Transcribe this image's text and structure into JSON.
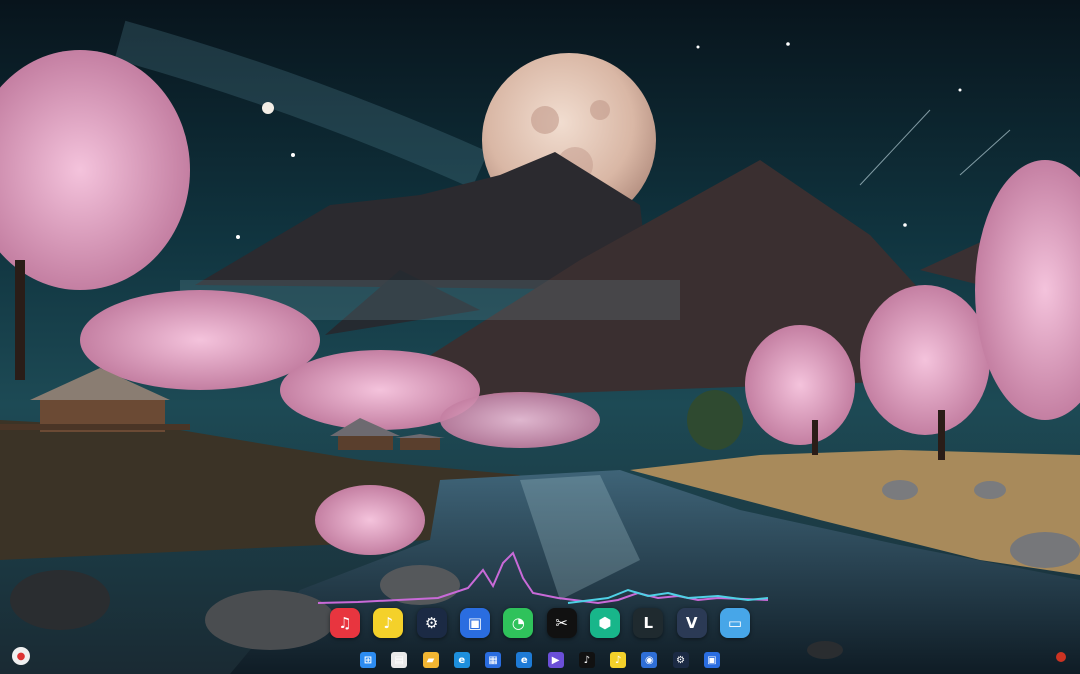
{
  "desktop": {
    "wallpaper_scene": "moonlit-mountains-cherry-blossoms"
  },
  "dock": {
    "apps": [
      {
        "name": "netease-music-icon",
        "glyph": "♫",
        "color": "#e8353f"
      },
      {
        "name": "qq-music-icon",
        "glyph": "♪",
        "color": "#f4d12a"
      },
      {
        "name": "steam-icon",
        "glyph": "⚙",
        "color": "#1b2a44"
      },
      {
        "name": "screenshot-icon",
        "glyph": "▣",
        "color": "#2a6de0"
      },
      {
        "name": "wechat-icon",
        "glyph": "◔",
        "color": "#2fc25b"
      },
      {
        "name": "capcut-icon",
        "glyph": "✂",
        "color": "#111111"
      },
      {
        "name": "app-green-icon",
        "glyph": "⬢",
        "color": "#18b68a"
      },
      {
        "name": "league-icon",
        "glyph": "L",
        "color": "#1f2a2f"
      },
      {
        "name": "v-app-icon",
        "glyph": "V",
        "color": "#2b3a55"
      },
      {
        "name": "monitor-icon",
        "glyph": "▭",
        "color": "#47a6e8"
      }
    ]
  },
  "taskbar": {
    "items": [
      {
        "name": "start-icon",
        "glyph": "⊞",
        "color": "#2d8cf0"
      },
      {
        "name": "file-icon",
        "glyph": "▤",
        "color": "#e9e9e9"
      },
      {
        "name": "folder-icon",
        "glyph": "▰",
        "color": "#f2b632"
      },
      {
        "name": "edge-icon",
        "glyph": "e",
        "color": "#1d8fdc"
      },
      {
        "name": "store-icon",
        "glyph": "▦",
        "color": "#2a6de0"
      },
      {
        "name": "ie-icon",
        "glyph": "e",
        "color": "#1e7bd6"
      },
      {
        "name": "player-icon",
        "glyph": "▶",
        "color": "#6b4fd8"
      },
      {
        "name": "tiktok-icon",
        "glyph": "♪",
        "color": "#111111"
      },
      {
        "name": "qq-music-small-icon",
        "glyph": "♪",
        "color": "#f4d12a"
      },
      {
        "name": "browser-icon",
        "glyph": "◉",
        "color": "#2f6fd6"
      },
      {
        "name": "steam-small-icon",
        "glyph": "⚙",
        "color": "#1b2a44"
      },
      {
        "name": "screenshot-small-icon",
        "glyph": "▣",
        "color": "#2a6de0"
      }
    ]
  }
}
